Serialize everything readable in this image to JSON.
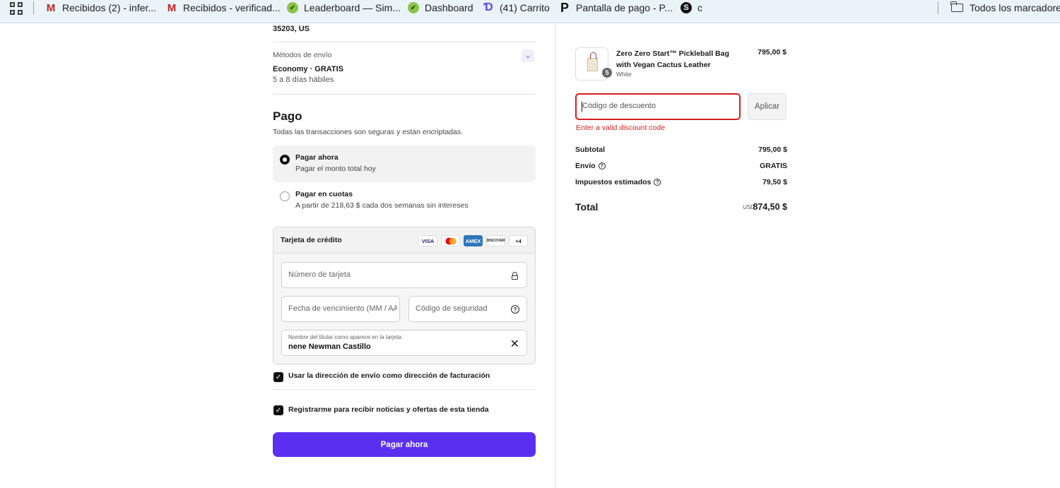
{
  "bookmarks": {
    "items": [
      {
        "icon": "gmail-icon",
        "label": "Recibidos (2) - infer..."
      },
      {
        "icon": "gmail-icon",
        "label": "Recibidos - verificad..."
      },
      {
        "icon": "leaf-icon",
        "label": "Leaderboard — Sim..."
      },
      {
        "icon": "leaf-icon",
        "label": "Dashboard"
      },
      {
        "icon": "d-logo-icon",
        "label": "(41) Carrito"
      },
      {
        "icon": "p-logo-icon",
        "label": "Pantalla de pago - P..."
      },
      {
        "icon": "s-logo-icon",
        "label": "c"
      }
    ],
    "all_bookmarks": "Todos los marcadores"
  },
  "shipping": {
    "address_tail": "35203, US",
    "methods_label": "Métodos de envío",
    "method": "Economy · GRATIS",
    "days": "5 a 8 días hábiles"
  },
  "payment": {
    "title": "Pago",
    "subtitle": "Todas las transacciones son seguras y están encriptadas.",
    "options": [
      {
        "title": "Pagar ahora",
        "subtitle": "Pagar el monto total hoy",
        "selected": true
      },
      {
        "title": "Pagar en cuotas",
        "subtitle": "A partir de 218,63 $ cada dos semanas sin intereses",
        "selected": false
      }
    ],
    "card": {
      "title": "Tarjeta de crédito",
      "brands": [
        "VISA",
        "MC",
        "AMEX",
        "DISCOVER",
        "+4"
      ],
      "number_placeholder": "Número de tarjeta",
      "expiry_placeholder": "Fecha de vencimiento (MM / AA)",
      "cvv_placeholder": "Código de seguridad",
      "name_label": "Nombre del titular como aparece en la tarjeta",
      "name_value": "nene Newman Castillo"
    },
    "billing_same": "Usar la dirección de envío como dirección de facturación",
    "newsletter": "Registrarme para recibir noticias y ofertas de esta tienda",
    "pay_button": "Pagar ahora"
  },
  "summary": {
    "product": {
      "quantity": "5",
      "name": "Zero Zero Start™ Pickleball Bag with Vegan Cactus Leather",
      "variant": "White",
      "price": "795,00 $"
    },
    "discount_placeholder": "Código de descuento",
    "apply_button": "Aplicar",
    "discount_error": "Enter a valid discount code",
    "subtotal_label": "Subtotal",
    "subtotal_value": "795,00 $",
    "shipping_label": "Envío",
    "shipping_value": "GRATIS",
    "taxes_label": "Impuestos estimados",
    "taxes_value": "79,50 $",
    "total_label": "Total",
    "total_currency": "USD",
    "total_value": "874,50 $"
  },
  "colors": {
    "accent": "#5b2ff0",
    "error": "#d51f1f"
  }
}
